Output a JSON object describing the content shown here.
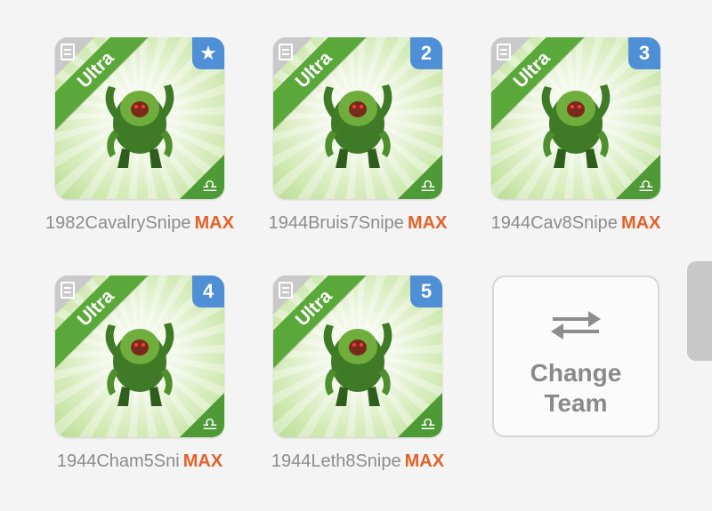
{
  "team": [
    {
      "name": "1982CavalrySnipe",
      "level": "MAX",
      "rarity": "Ultra",
      "slot": "★",
      "slot_icon": "star-icon"
    },
    {
      "name": "1944Bruis7Snipe",
      "level": "MAX",
      "rarity": "Ultra",
      "slot": "2"
    },
    {
      "name": "1944Cav8Snipe",
      "level": "MAX",
      "rarity": "Ultra",
      "slot": "3"
    },
    {
      "name": "1944Cham5Sni",
      "level": "MAX",
      "rarity": "Ultra",
      "slot": "4"
    },
    {
      "name": "1944Leth8Snipe",
      "level": "MAX",
      "rarity": "Ultra",
      "slot": "5"
    }
  ],
  "change_team": {
    "line1": "Change",
    "line2": "Team",
    "icon": "swap-arrows-icon"
  },
  "colors": {
    "ultra_ribbon": "#5aa83a",
    "slot_badge": "#4f8fd6",
    "max_label": "#e2622a",
    "element": "#4e9a36"
  },
  "element_icon": "libra-icon"
}
